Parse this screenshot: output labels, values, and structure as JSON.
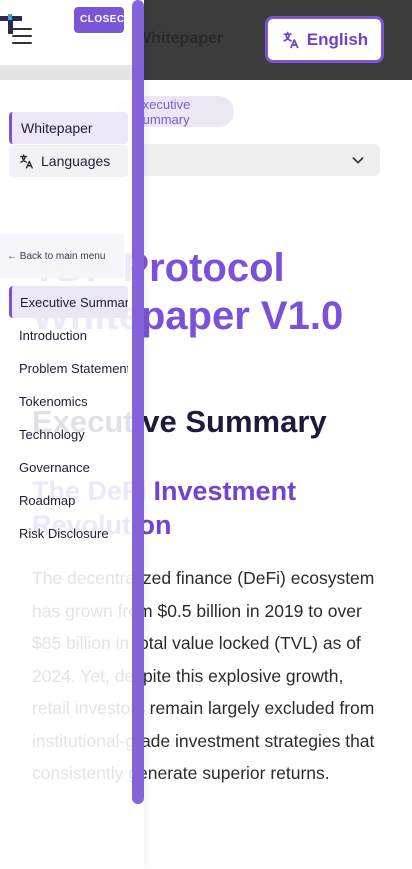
{
  "header": {
    "title": "Whitepaper",
    "language_button": {
      "label": "English",
      "icon": "translate-icon"
    }
  },
  "breadcrumb": {
    "current": "Executive Summary"
  },
  "document_select": {
    "icon": "chevron-down-icon"
  },
  "content": {
    "page_title": "TDP Protocol Whitepaper V1.0",
    "section_title": "Executive Summary",
    "subsection_title": "The DeFi Investment Revolution",
    "paragraph": "The decentralized finance (DeFi) ecosystem has grown from $0.5 billion in 2019 to over $85 billion in total value locked (TVL) as of 2024. Yet, despite this explosive growth, retail investors remain largely excluded from institutional-grade investment strategies that consistently generate superior returns."
  },
  "drawer": {
    "brand": "CLOSECLOSE",
    "logo_icon": "logo-mark-icon",
    "menu_icon": "hamburger-icon",
    "primary_nav": [
      {
        "label": "Whitepaper",
        "active": true
      },
      {
        "label": "Languages",
        "icon": "translate-icon",
        "active": false
      }
    ],
    "back_link": "← Back to main menu",
    "sections": [
      {
        "label": "Executive Summary",
        "active": true
      },
      {
        "label": "Introduction",
        "active": false
      },
      {
        "label": "Problem Statement",
        "active": false
      },
      {
        "label": "Tokenomics",
        "active": false
      },
      {
        "label": "Technology",
        "active": false
      },
      {
        "label": "Governance",
        "active": false
      },
      {
        "label": "Roadmap",
        "active": false
      },
      {
        "label": "Risk Disclosure",
        "active": false
      }
    ]
  },
  "colors": {
    "accent": "#7b56d9",
    "header_bg": "#3c3c3c",
    "active_bg": "#ebe7f7",
    "heading_dark": "#1d1b3a"
  }
}
